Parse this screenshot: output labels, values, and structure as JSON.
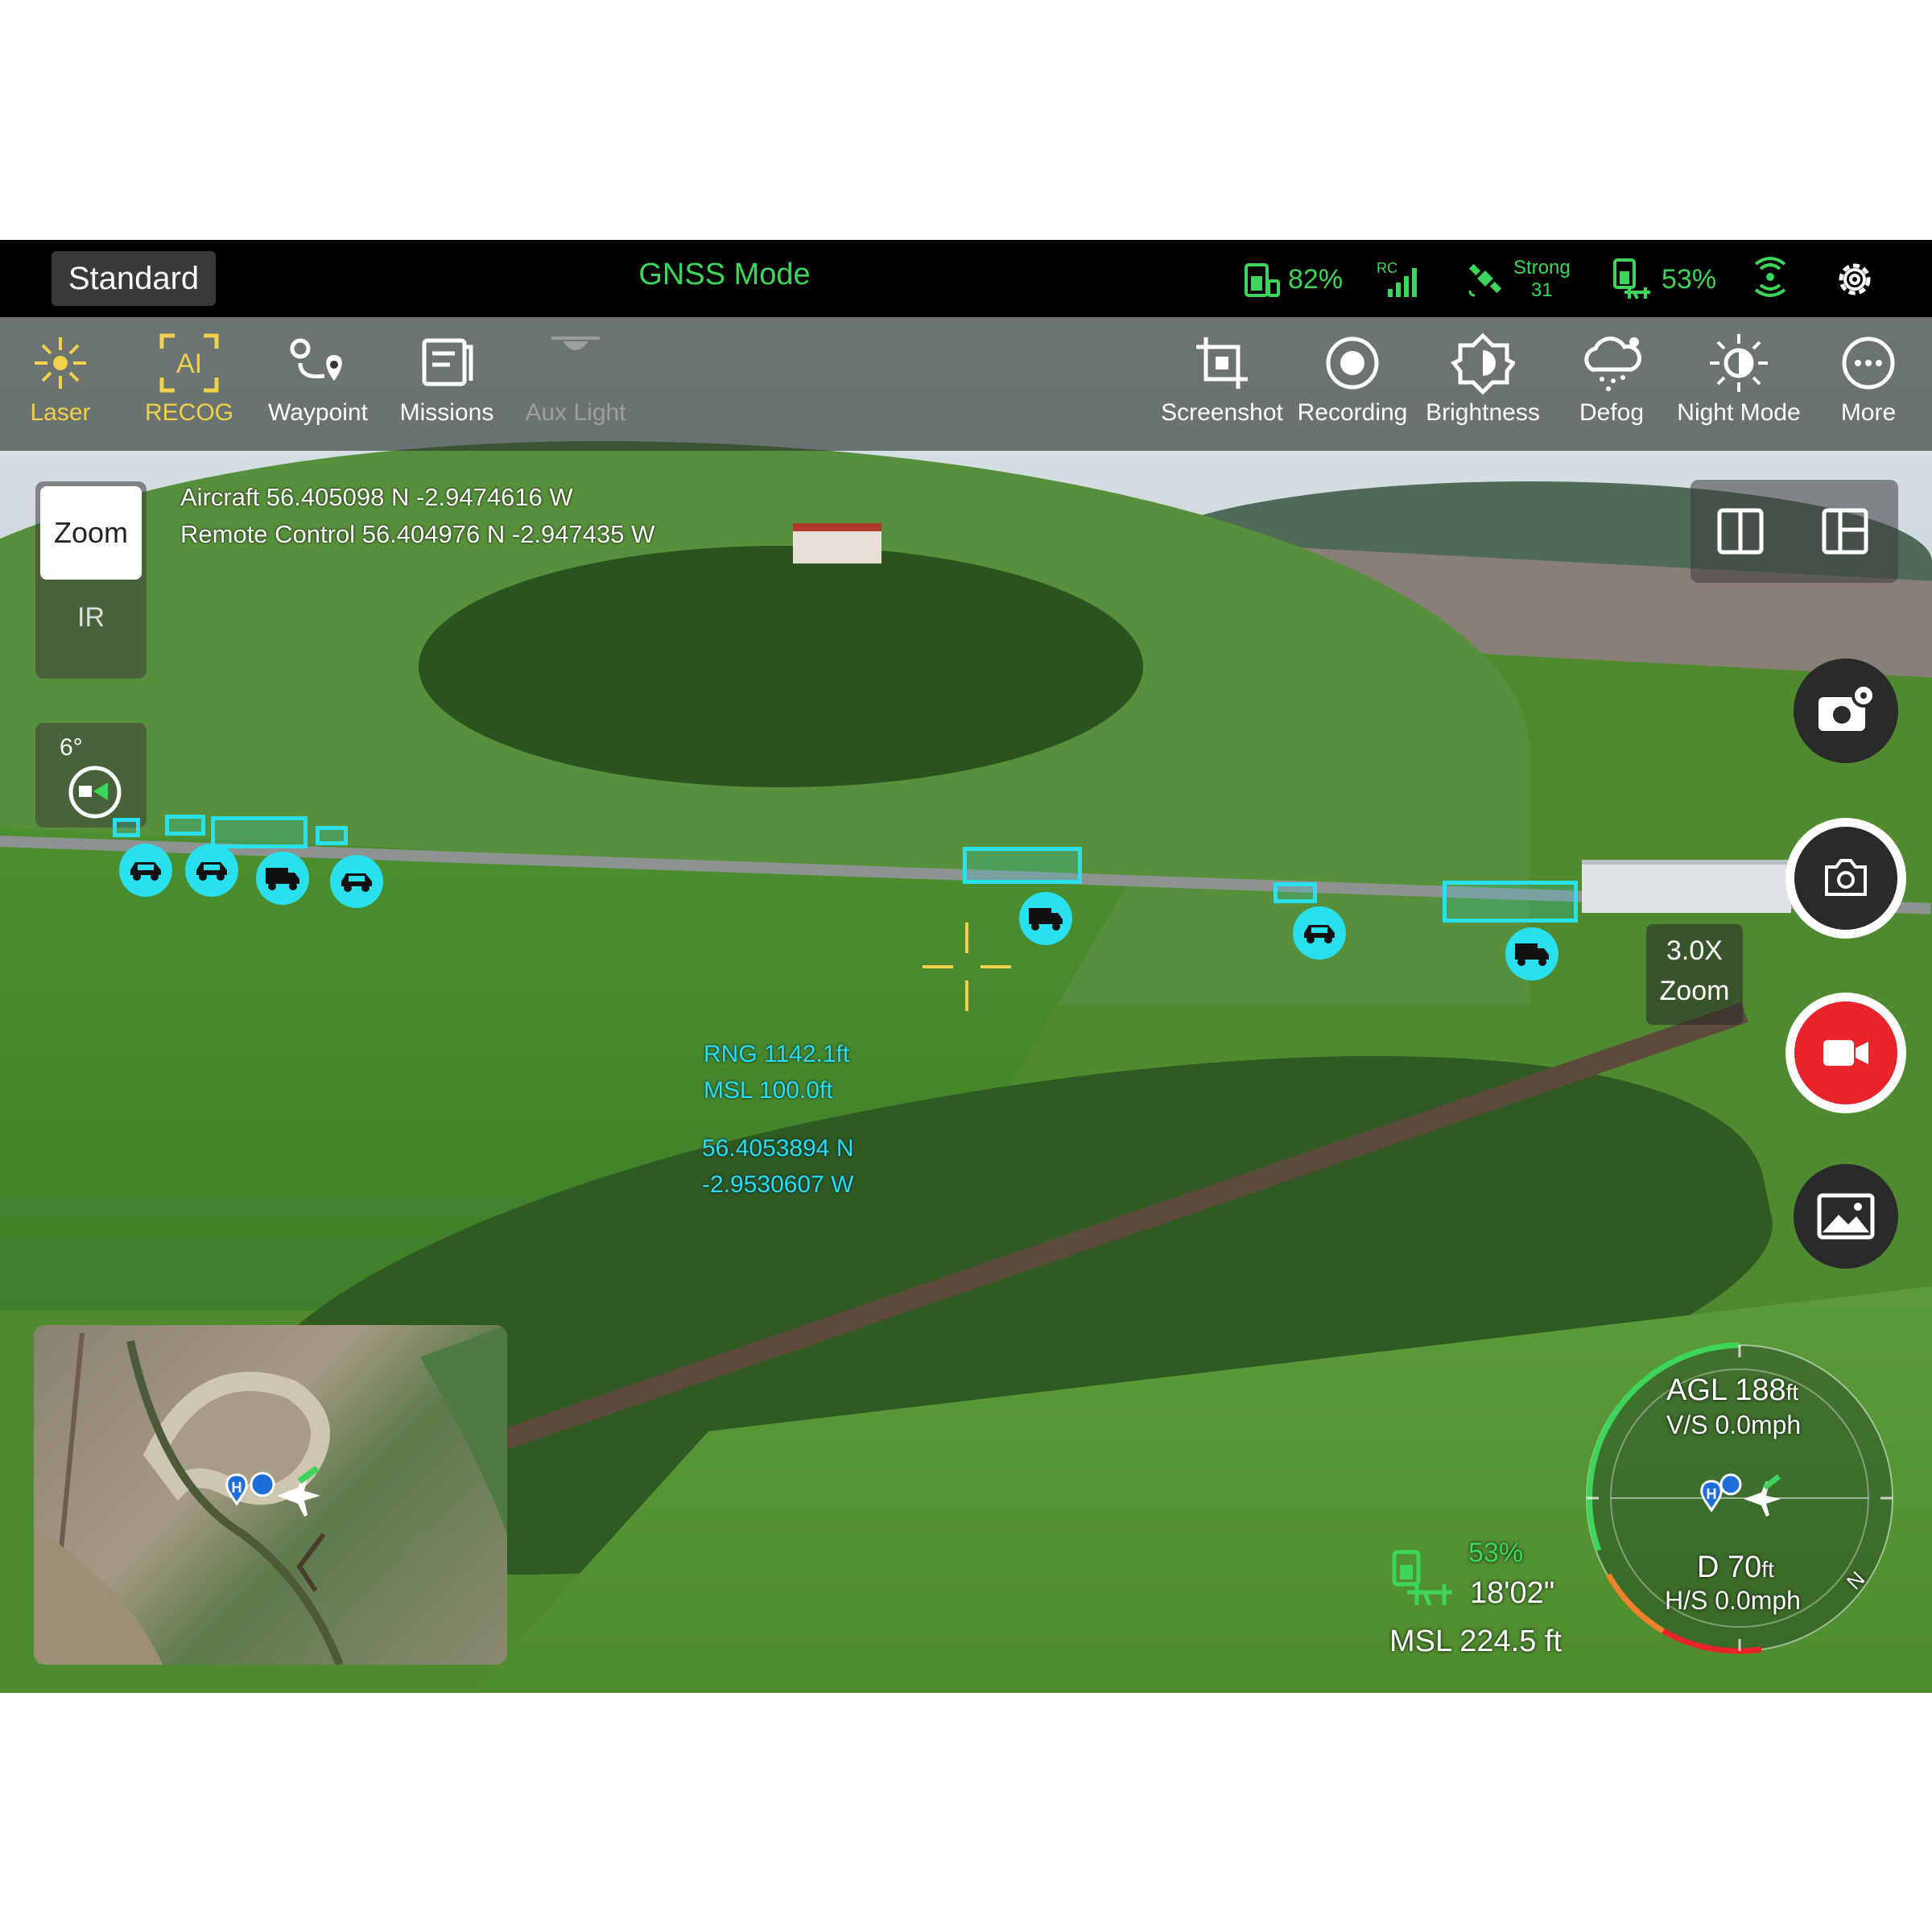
{
  "status_bar": {
    "flight_mode_button": "Standard",
    "positioning_mode": "GNSS Mode",
    "rc_battery": "82%",
    "rc_signal_label": "RC",
    "gnss_strength": "Strong",
    "satellite_count": "31",
    "aircraft_battery": "53%",
    "icons": [
      "rc-battery-icon",
      "rc-signal-icon",
      "satellite-icon",
      "aircraft-battery-icon",
      "transmission-icon",
      "settings-gear-icon"
    ]
  },
  "toolbar": {
    "left_tools": [
      {
        "label": "Laser",
        "icon": "laser-icon",
        "color": "#f2d04a"
      },
      {
        "label": "RECOG",
        "icon": "ai-recog-icon",
        "color": "#f2d04a"
      },
      {
        "label": "Waypoint",
        "icon": "waypoint-icon",
        "color": "#ffffff"
      },
      {
        "label": "Missions",
        "icon": "missions-icon",
        "color": "#ffffff"
      },
      {
        "label": "Aux Light",
        "icon": "aux-light-icon",
        "color": "#9aa09c"
      }
    ],
    "right_tools": [
      {
        "label": "Screenshot",
        "icon": "screenshot-crop-icon"
      },
      {
        "label": "Recording",
        "icon": "recording-icon"
      },
      {
        "label": "Brightness",
        "icon": "brightness-icon"
      },
      {
        "label": "Defog",
        "icon": "defog-icon"
      },
      {
        "label": "Night Mode",
        "icon": "night-mode-icon"
      },
      {
        "label": "More",
        "icon": "more-icon"
      }
    ]
  },
  "position": {
    "aircraft": "Aircraft  56.405098 N -2.9474616 W",
    "remote_control": "Remote Control 56.404976 N  -2.947435 W"
  },
  "camera_switch": {
    "zoom": "Zoom",
    "ir": "IR"
  },
  "gimbal": {
    "angle": "6°"
  },
  "zoom_indicator": {
    "value": "3.0X",
    "label": "Zoom"
  },
  "laser": {
    "rng": "RNG  1142.1ft",
    "msl": "MSL  100.0ft",
    "lat": "56.4053894 N",
    "lon": "-2.9530607 W"
  },
  "telemetry": {
    "agl_label": "AGL",
    "agl_value": "188",
    "agl_unit": "ft",
    "vs": "V/S 0.0mph",
    "distance_label": "D",
    "distance_value": "70",
    "distance_unit": "ft",
    "hs": "H/S 0.0mph",
    "battery_percent": "53%",
    "flight_time": "18'02\"",
    "msl_altitude": "MSL 224.5 ft",
    "compass_letter": "N",
    "home_marker": "H"
  },
  "detections": [
    "car",
    "car",
    "truck",
    "car",
    "truck",
    "car",
    "truck"
  ],
  "colors": {
    "accent_green": "#3ed65a",
    "detection_cyan": "#28e0ee",
    "active_yellow": "#f2d04a",
    "record_red": "#e8232a"
  }
}
